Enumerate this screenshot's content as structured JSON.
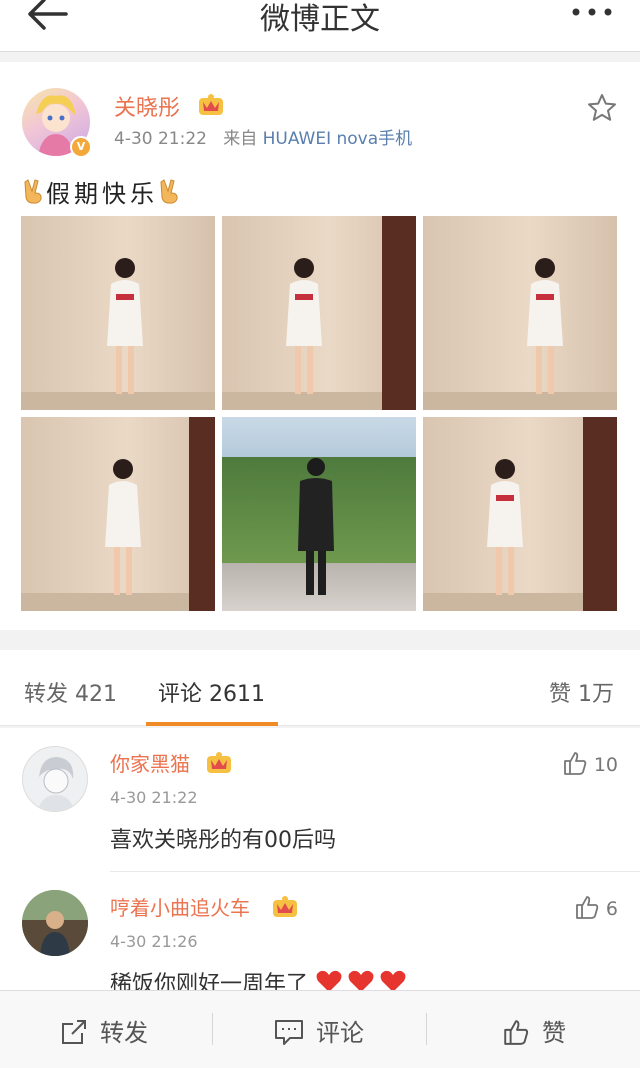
{
  "header": {
    "title": "微博正文"
  },
  "post": {
    "author": "关晓彤",
    "time": "4-30 21:22",
    "source_prefix": "来自",
    "source": "HUAWEI nova手机",
    "text": "假期快乐",
    "photos": [
      "photo-1",
      "photo-2",
      "photo-3",
      "photo-4",
      "photo-5",
      "photo-6"
    ]
  },
  "tabs": {
    "repost": "转发 421",
    "comment": "评论 2611",
    "like": "赞 1万"
  },
  "comments": [
    {
      "name": "你家黑猫",
      "time": "4-30 21:22",
      "text": "喜欢关晓彤的有00后吗",
      "likes": "10"
    },
    {
      "name": "哼着小曲追火车",
      "time": "4-30 21:26",
      "text": "稀饭你刚好一周年了",
      "likes": "6"
    }
  ],
  "bottom_bar": {
    "repost": "转发",
    "comment": "评论",
    "like": "赞"
  },
  "colors": {
    "accent": "#f08a24",
    "username": "#eb7350",
    "source_link": "#5a7fae"
  }
}
